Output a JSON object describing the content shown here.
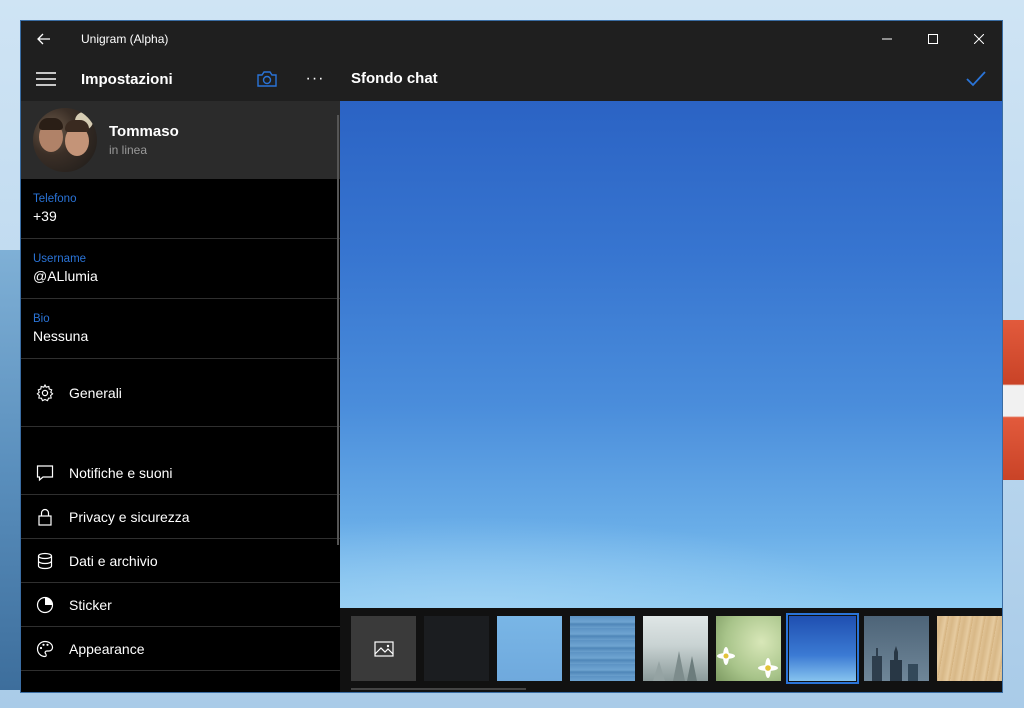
{
  "window": {
    "title": "Unigram (Alpha)"
  },
  "appbar": {
    "settings_title": "Impostazioni",
    "detail_title": "Sfondo chat",
    "more_label": "···"
  },
  "profile": {
    "name": "Tommaso",
    "status": "in linea"
  },
  "fields": [
    {
      "label": "Telefono",
      "value": "+39"
    },
    {
      "label": "Username",
      "value": "@ALlumia"
    },
    {
      "label": "Bio",
      "value": "Nessuna"
    }
  ],
  "menu": [
    {
      "label": "Generali",
      "icon": "gear-icon"
    },
    {
      "label": "Notifiche e suoni",
      "icon": "chat-bubble-icon"
    },
    {
      "label": "Privacy e sicurezza",
      "icon": "lock-icon"
    },
    {
      "label": "Dati e archivio",
      "icon": "database-icon"
    },
    {
      "label": "Sticker",
      "icon": "sticker-icon"
    },
    {
      "label": "Appearance",
      "icon": "palette-icon"
    }
  ],
  "colors": {
    "accent": "#2a74d8",
    "chrome": "#1f1f1f"
  },
  "wallpapers": [
    {
      "name": "custom-picker",
      "icon": "image-icon"
    },
    {
      "name": "dark"
    },
    {
      "name": "light-blue"
    },
    {
      "name": "blue-wood"
    },
    {
      "name": "foggy-forest"
    },
    {
      "name": "daisies"
    },
    {
      "name": "blue-gradient",
      "selected": true
    },
    {
      "name": "city-skyline"
    },
    {
      "name": "light-wood"
    }
  ]
}
